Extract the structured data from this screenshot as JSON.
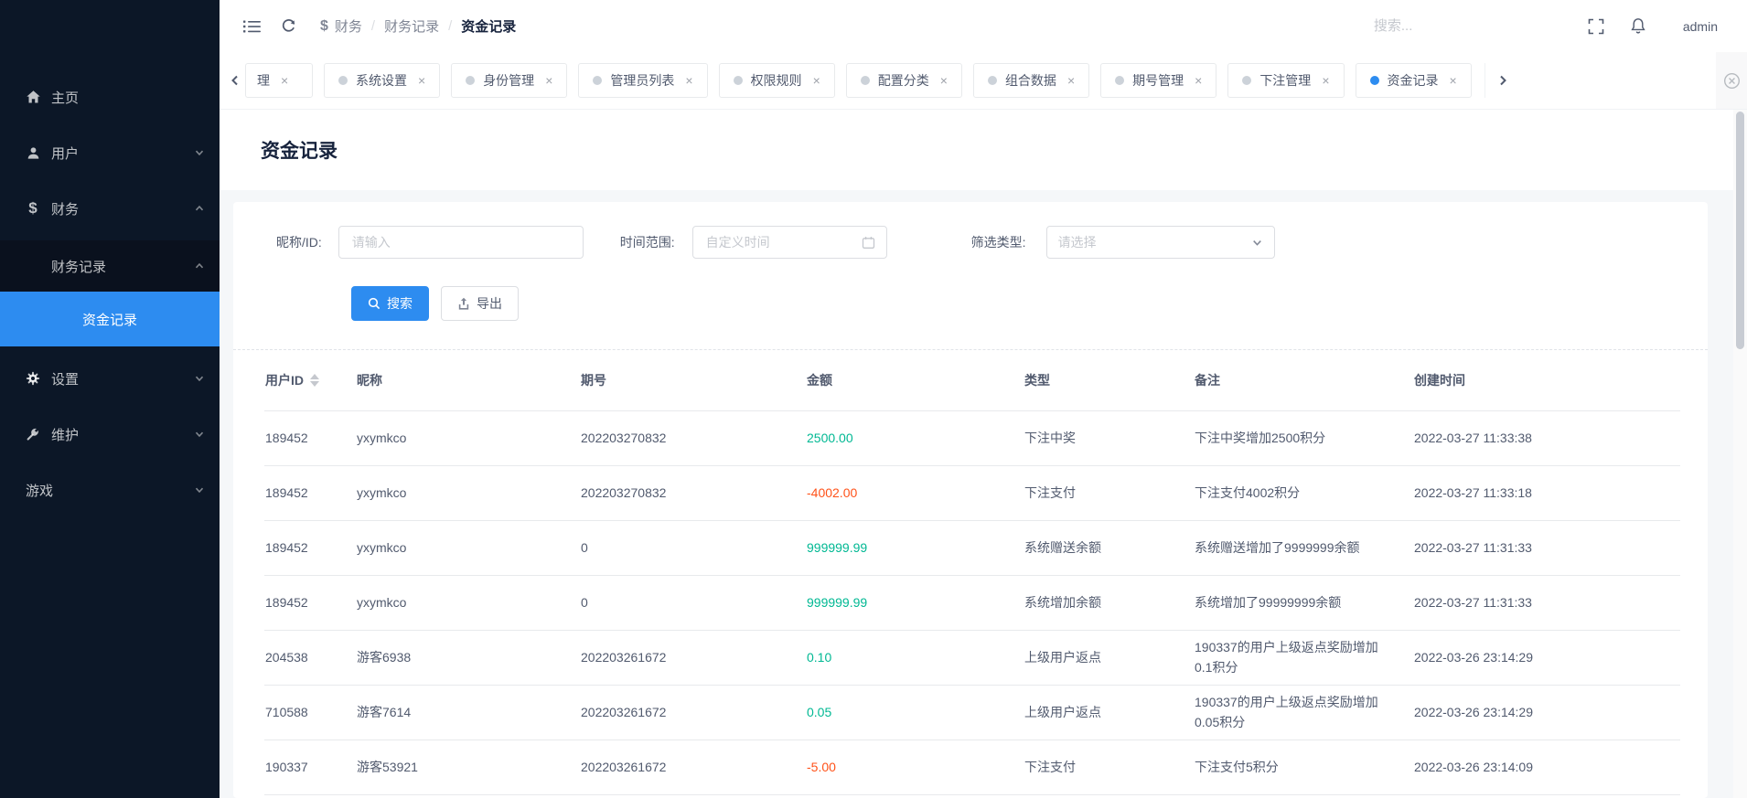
{
  "sidebar": {
    "items": [
      {
        "label": "主页",
        "icon": "home-icon"
      },
      {
        "label": "用户",
        "icon": "user-icon",
        "chevron": "down"
      },
      {
        "label": "财务",
        "icon": "dollar-icon",
        "chevron": "up"
      },
      {
        "label": "财务记录",
        "chevron": "up"
      },
      {
        "label": "资金记录",
        "active": true
      },
      {
        "label": "设置",
        "icon": "gear-icon",
        "chevron": "down"
      },
      {
        "label": "维护",
        "icon": "wrench-icon",
        "chevron": "down"
      },
      {
        "label": "游戏",
        "chevron": "down"
      }
    ]
  },
  "topbar": {
    "breadcrumb": {
      "items": [
        "财务",
        "财务记录",
        "资金记录"
      ],
      "separator": "/"
    },
    "search_placeholder": "搜索...",
    "username": "admin"
  },
  "tabbar": {
    "partial_tab": "理",
    "tabs": [
      "系统设置",
      "身份管理",
      "管理员列表",
      "权限规则",
      "配置分类",
      "组合数据",
      "期号管理",
      "下注管理",
      "资金记录"
    ],
    "active_tab": "资金记录"
  },
  "page": {
    "title": "资金记录"
  },
  "filters": {
    "nickname_label": "昵称/ID:",
    "nickname_placeholder": "请输入",
    "time_label": "时间范围:",
    "time_placeholder": "自定义时间",
    "type_label": "筛选类型:",
    "type_placeholder": "请选择",
    "search_button": "搜索",
    "export_button": "导出"
  },
  "table": {
    "columns": [
      "用户ID",
      "昵称",
      "期号",
      "金额",
      "类型",
      "备注",
      "创建时间"
    ],
    "rows": [
      {
        "user_id": "189452",
        "nickname": "yxymkco",
        "period": "202203270832",
        "amount": "2500.00",
        "type": "下注中奖",
        "remark": "下注中奖增加2500积分",
        "created_at": "2022-03-27 11:33:38"
      },
      {
        "user_id": "189452",
        "nickname": "yxymkco",
        "period": "202203270832",
        "amount": "-4002.00",
        "type": "下注支付",
        "remark": "下注支付4002积分",
        "created_at": "2022-03-27 11:33:18"
      },
      {
        "user_id": "189452",
        "nickname": "yxymkco",
        "period": "0",
        "amount": "999999.99",
        "type": "系统赠送余额",
        "remark": "系统赠送增加了9999999余额",
        "created_at": "2022-03-27 11:31:33"
      },
      {
        "user_id": "189452",
        "nickname": "yxymkco",
        "period": "0",
        "amount": "999999.99",
        "type": "系统增加余额",
        "remark": "系统增加了99999999余额",
        "created_at": "2022-03-27 11:31:33"
      },
      {
        "user_id": "204538",
        "nickname": "游客6938",
        "period": "202203261672",
        "amount": "0.10",
        "type": "上级用户返点",
        "remark": "190337的用户上级返点奖励增加0.1积分",
        "created_at": "2022-03-26 23:14:29"
      },
      {
        "user_id": "710588",
        "nickname": "游客7614",
        "period": "202203261672",
        "amount": "0.05",
        "type": "上级用户返点",
        "remark": "190337的用户上级返点奖励增加0.05积分",
        "created_at": "2022-03-26 23:14:29"
      },
      {
        "user_id": "190337",
        "nickname": "游客53921",
        "period": "202203261672",
        "amount": "-5.00",
        "type": "下注支付",
        "remark": "下注支付5积分",
        "created_at": "2022-03-26 23:14:09"
      }
    ]
  },
  "icons": {
    "close": "×",
    "dollar": "$"
  },
  "colors": {
    "accent": "#2d8cf0",
    "positive_amount": "#00b893",
    "negative_amount": "#ff5219",
    "sidebar_bg": "#0c1727",
    "submenu_bg": "#0a111e"
  }
}
